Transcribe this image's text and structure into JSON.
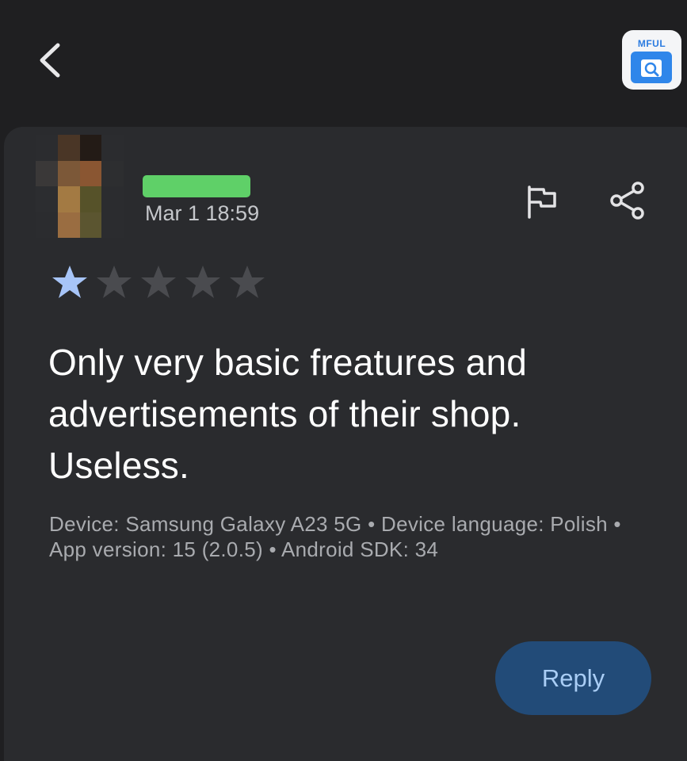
{
  "header": {
    "back_icon": "chevron-left-icon",
    "app_icon_label": "MFUL",
    "app_icon": "app-magnifier-icon"
  },
  "review": {
    "date": "Mar 1 18:59",
    "rating": 1,
    "max_rating": 5,
    "text": "Only very basic freatures and advertisements of their shop. Useless.",
    "device": "Device: Samsung Galaxy A23 5G",
    "language": "Device language: Polish",
    "app_version": "App version: 15 (2.0.5)",
    "sdk": "Android SDK: 34",
    "separator": "•"
  },
  "actions": {
    "flag_icon": "flag-icon",
    "share_icon": "share-icon",
    "reply_label": "Reply"
  },
  "colors": {
    "background": "#1f1f21",
    "card": "#2a2b2e",
    "star_filled": "#a7c5f8",
    "star_empty": "#4a4b4f",
    "reply_bg": "#224b78",
    "reply_text": "#a9cdf5",
    "name_redaction": "#5fd068"
  }
}
